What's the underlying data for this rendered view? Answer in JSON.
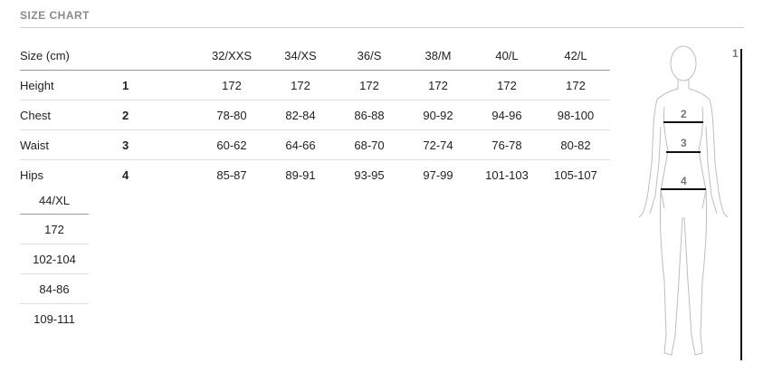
{
  "title": "SIZE CHART",
  "table": {
    "header_label": "Size (cm)",
    "sizes": [
      "32/XXS",
      "34/XS",
      "36/S",
      "38/M",
      "40/L",
      "42/L"
    ],
    "rows": [
      {
        "label": "Height",
        "number": "1",
        "values": [
          "172",
          "172",
          "172",
          "172",
          "172",
          "172"
        ]
      },
      {
        "label": "Chest",
        "number": "2",
        "values": [
          "78-80",
          "82-84",
          "86-88",
          "90-92",
          "94-96",
          "98-100"
        ]
      },
      {
        "label": "Waist",
        "number": "3",
        "values": [
          "60-62",
          "64-66",
          "68-70",
          "72-74",
          "76-78",
          "80-82"
        ]
      },
      {
        "label": "Hips",
        "number": "4",
        "values": [
          "85-87",
          "89-91",
          "93-95",
          "97-99",
          "101-103",
          "105-107"
        ]
      }
    ]
  },
  "overflow_column": {
    "size": "44/XL",
    "values": [
      "172",
      "102-104",
      "84-86",
      "109-111"
    ]
  },
  "figure": {
    "labels": [
      "1",
      "2",
      "3",
      "4"
    ]
  },
  "colors": {
    "title": "#8a8a8a",
    "rule": "#cfcfcf",
    "figure_outline": "#bdbdbd",
    "measure_line": "#111111"
  }
}
